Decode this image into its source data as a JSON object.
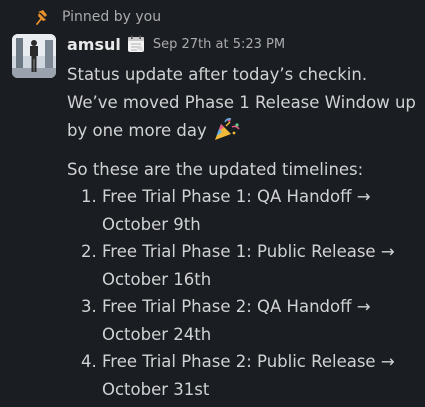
{
  "pinned": {
    "label": "Pinned by you",
    "icon": "pin-icon",
    "icon_color": "#e8912d"
  },
  "message": {
    "author": "amsul",
    "status_icon": "calendar-icon",
    "timestamp": "Sep 27th at 5:23 PM",
    "text_part1": "Status update after today’s checkin. We’ve moved Phase 1 Release Window up by one more day",
    "emoji": "party-popper-icon",
    "intro": "So these are the updated timelines:",
    "items": [
      "Free Trial Phase 1: QA Handoff → October 9th",
      "Free Trial Phase 1: Public Release → October 16th",
      "Free Trial Phase 2: QA Handoff → October 24th",
      "Free Trial Phase 2: Public Release → October 31st"
    ]
  },
  "colors": {
    "background": "#1a1d21",
    "text": "#d1d2d3",
    "muted": "#ababad"
  }
}
